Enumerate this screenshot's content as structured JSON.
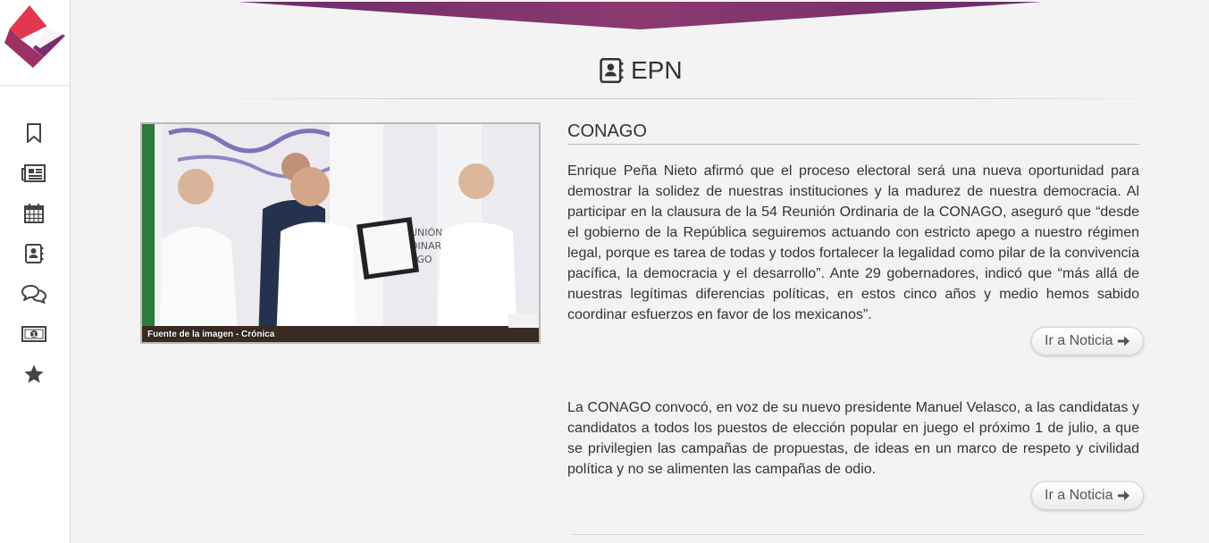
{
  "brand": {
    "accent": "#8b3a6e",
    "logo_colors": [
      "#e2384f",
      "#7b2e6e"
    ]
  },
  "sidebar": {
    "items": [
      {
        "icon": "bookmark-icon"
      },
      {
        "icon": "newspaper-icon"
      },
      {
        "icon": "calendar-icon"
      },
      {
        "icon": "contact-card-icon"
      },
      {
        "icon": "comments-icon"
      },
      {
        "icon": "money-icon"
      },
      {
        "icon": "star-icon"
      }
    ]
  },
  "section": {
    "title": "EPN",
    "icon": "contact-card-icon"
  },
  "photo": {
    "caption": "Fuente de la imagen - Crónica"
  },
  "articles": [
    {
      "heading": "CONAGO",
      "text": "Enrique Peña Nieto afirmó que el proceso electoral será una nueva oportunidad para demostrar la solidez de nuestras instituciones y la madurez de nuestra democracia. Al participar en la clausura de la 54 Reunión Ordinaria de la CONAGO, aseguró que “desde el gobierno de la República seguiremos actuando con estricto apego a nuestro régimen legal, porque es tarea de todas y todos fortalecer la legalidad como pilar de la convivencia pacífica, la democracia y el desarrollo”. Ante 29 gobernadores, indicó que “más allá de nuestras legítimas diferencias políticas, en estos cinco años y medio hemos sabido coordinar esfuerzos en favor de los mexicanos”.",
      "button": "Ir a Noticia"
    },
    {
      "text": "La CONAGO convocó, en voz de su nuevo presidente Manuel Velasco, a las candidatas y candidatos a todos los puestos de elección popular en juego el próximo 1 de julio, a que se privilegien las campañas de propuestas, de ideas en un marco de respeto y civilidad política y no se alimenten las campañas de odio.",
      "button": "Ir a Noticia"
    }
  ]
}
